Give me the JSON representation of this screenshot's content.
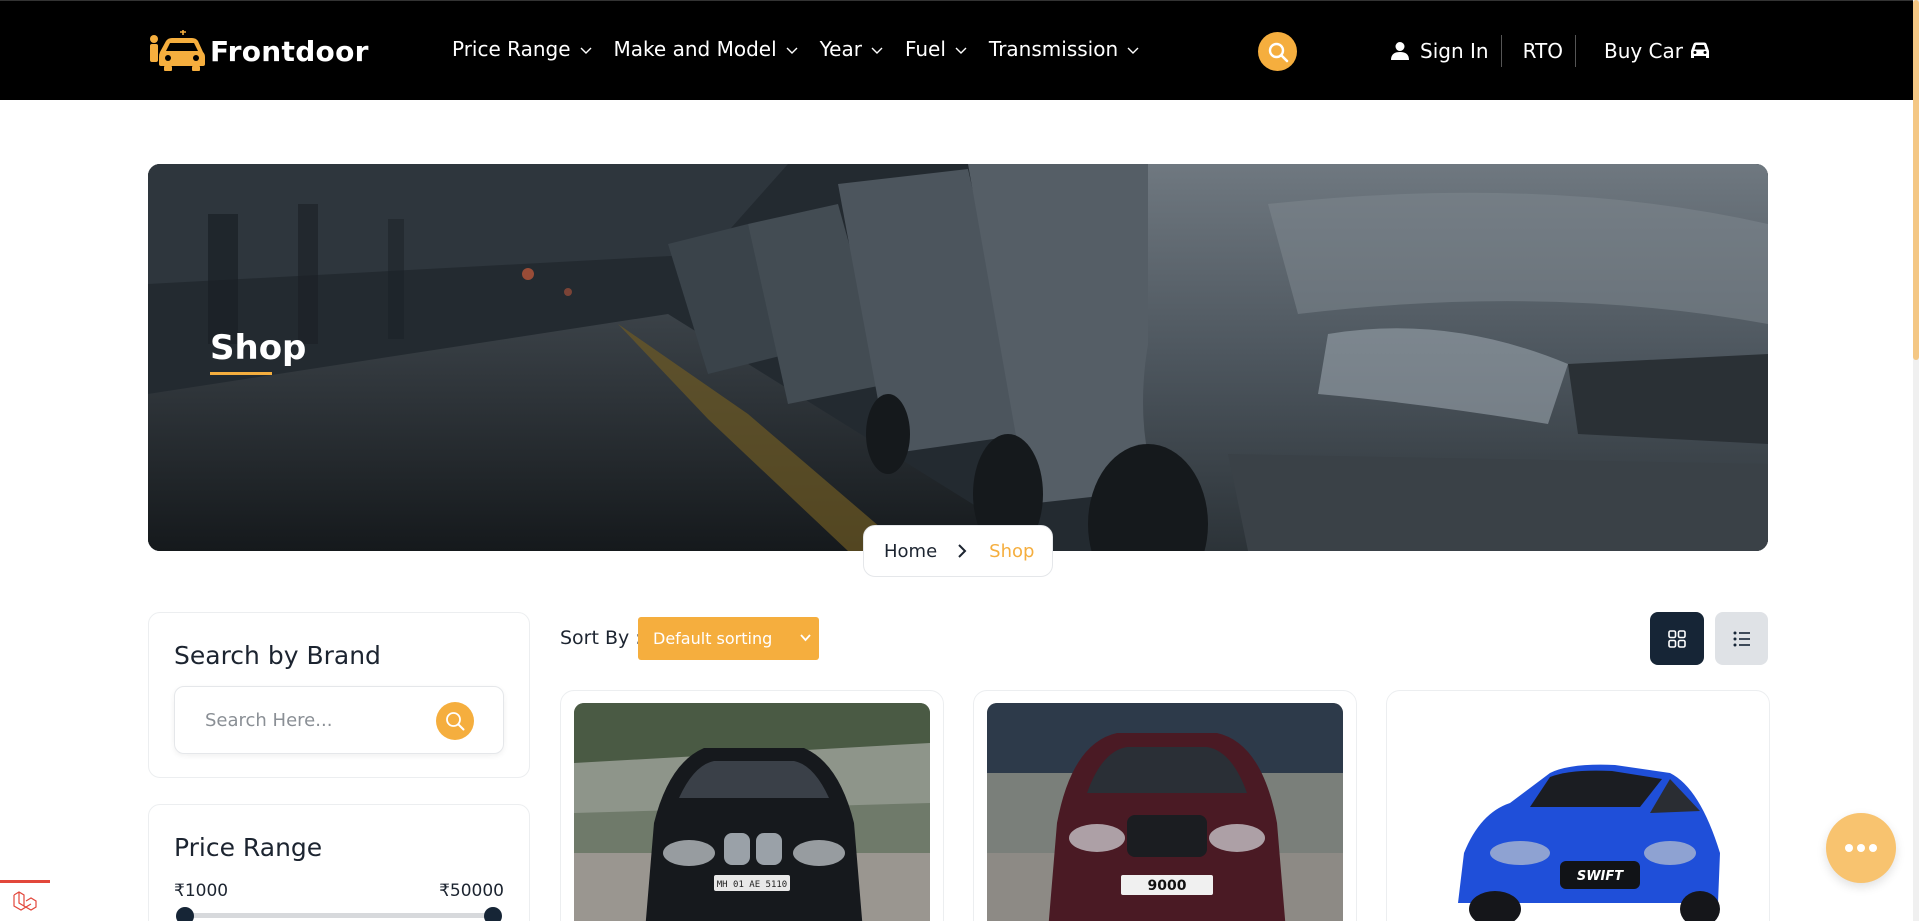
{
  "header": {
    "brand_name": "Frontdoor",
    "nav": [
      {
        "label": "Price Range"
      },
      {
        "label": "Make and Model"
      },
      {
        "label": "Year"
      },
      {
        "label": "Fuel"
      },
      {
        "label": "Transmission"
      }
    ],
    "sign_in": "Sign In",
    "rto": "RTO",
    "buy_car": "Buy Car"
  },
  "hero": {
    "title": "Shop",
    "breadcrumb": {
      "home": "Home",
      "current": "Shop"
    }
  },
  "sidebar": {
    "brand_search": {
      "title": "Search by Brand",
      "placeholder": "Search Here..."
    },
    "price_range": {
      "title": "Price Range",
      "min_label": "₹1000",
      "max_label": "₹50000",
      "low_fraction": 0.0,
      "high_fraction": 1.0
    }
  },
  "listing": {
    "sort_label": "Sort By :",
    "sort_value": "Default sorting",
    "products": [
      {
        "image": "black-sedan-photo",
        "plate": "MH 01 AE 5110"
      },
      {
        "image": "maroon-sedan-photo",
        "plate": "9000"
      },
      {
        "image": "blue-hatchback-photo",
        "plate": "SWIFT"
      }
    ]
  },
  "colors": {
    "accent": "#f5ae3e",
    "navy": "#162536",
    "header_bg": "#000000"
  },
  "icons": [
    "car-logo-icon",
    "chevron-down-icon",
    "search-icon",
    "user-icon",
    "car-icon",
    "chevron-right-icon",
    "grid-view-icon",
    "list-view-icon",
    "chat-dots-icon",
    "laravel-icon"
  ]
}
